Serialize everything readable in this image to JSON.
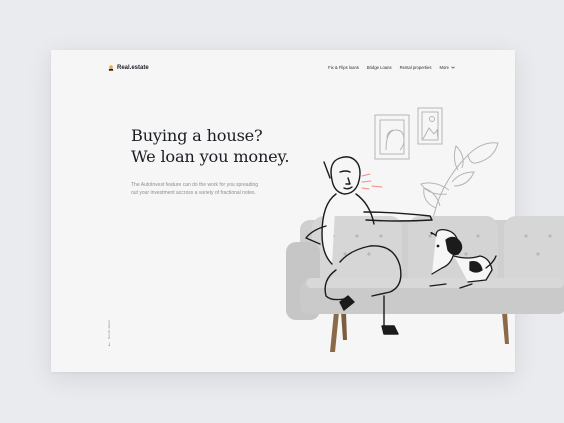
{
  "brand": {
    "name": "Real.estate",
    "accent": "#f2a93b"
  },
  "nav": {
    "items": [
      {
        "label": "Fix & Flips loans"
      },
      {
        "label": "Bridge Loans"
      },
      {
        "label": "Rental properties"
      },
      {
        "label": "More"
      }
    ]
  },
  "hero": {
    "headline_line1": "Buying a house?",
    "headline_line2": "We loan you money.",
    "subtext_line1": "The AutoInvest feature can do the work for you spreading",
    "subtext_line2": "out your investment accross a variety of fractional notes."
  },
  "scroll_hint": {
    "label": "Scroll down"
  },
  "colors": {
    "background": "#e9ebee",
    "card": "#f6f6f6",
    "text": "#1a1d24",
    "sofa": "#c8c8c8",
    "blush": "#f28b82"
  }
}
